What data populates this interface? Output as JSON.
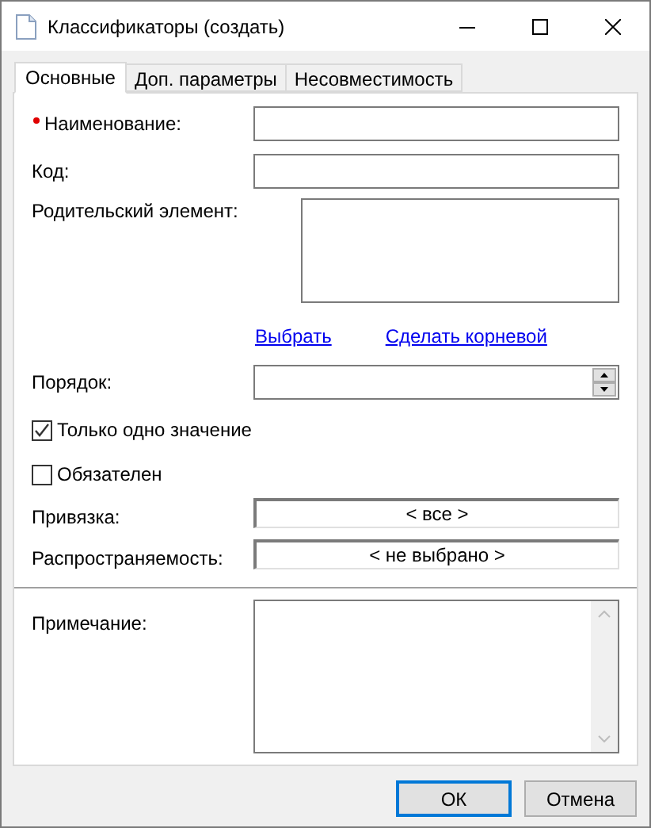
{
  "window": {
    "title": "Классификаторы (создать)"
  },
  "tabs": [
    {
      "label": "Основные",
      "selected": true
    },
    {
      "label": "Доп. параметры",
      "selected": false
    },
    {
      "label": "Несовместимость",
      "selected": false
    }
  ],
  "form": [
    {
      "kind": "text",
      "label": "Наименование:",
      "required": true
    },
    {
      "kind": "text",
      "label": "Код:",
      "required": false
    },
    {
      "kind": "textarea",
      "label": "Родительский элемент:"
    },
    {
      "kind": "links",
      "links": [
        "Выбрать",
        "Сделать корневой"
      ]
    },
    {
      "kind": "spin",
      "label": "Порядок:"
    },
    {
      "kind": "checkbox",
      "label": "Только одно значение",
      "checked": true
    },
    {
      "kind": "checkbox",
      "label": "Обязателен",
      "checked": false
    },
    {
      "kind": "selector",
      "label": "Привязка:",
      "value": "< все >"
    },
    {
      "kind": "selector",
      "label": "Распространяемость:",
      "value": "< не выбрано >"
    },
    {
      "kind": "divider"
    },
    {
      "kind": "memo",
      "label": "Примечание:"
    }
  ],
  "buttons": [
    {
      "label": "ОК",
      "default": true
    },
    {
      "label": "Отмена",
      "default": false
    }
  ]
}
